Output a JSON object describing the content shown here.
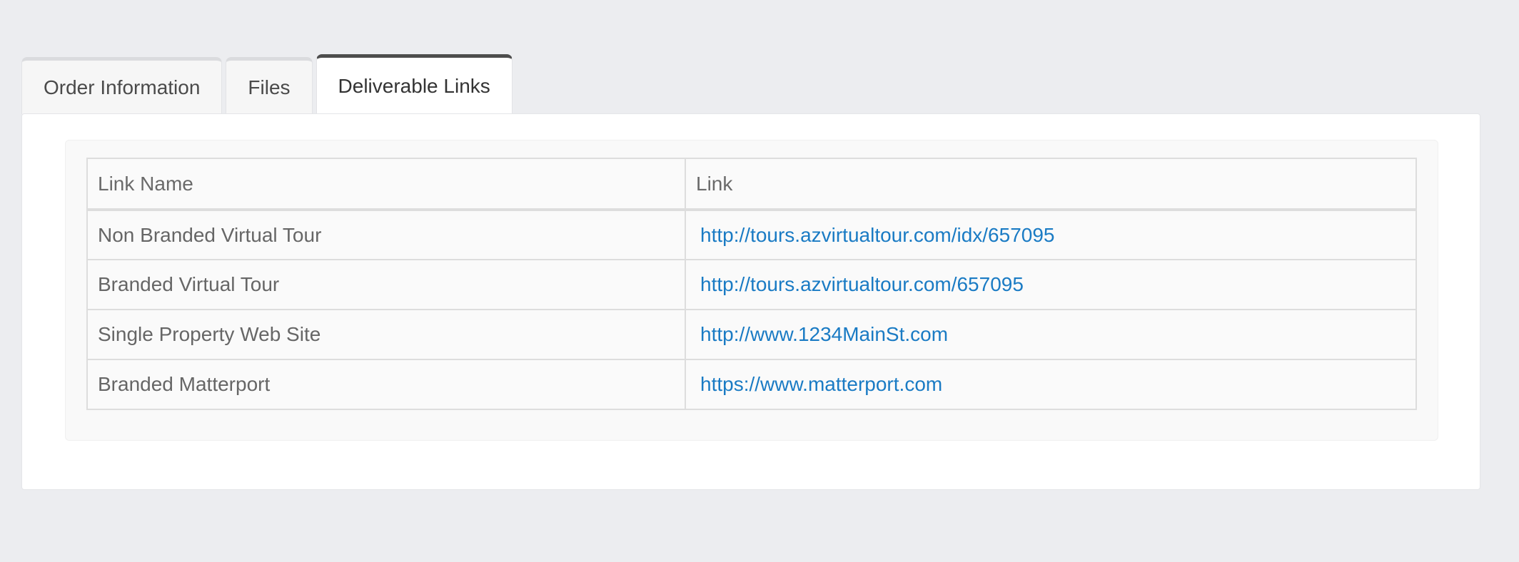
{
  "tabs": [
    {
      "label": "Order Information"
    },
    {
      "label": "Files"
    },
    {
      "label": "Deliverable Links"
    }
  ],
  "table": {
    "headers": {
      "name": "Link Name",
      "link": "Link"
    },
    "rows": [
      {
        "name": "Non Branded Virtual Tour",
        "link": "http://tours.azvirtualtour.com/idx/657095"
      },
      {
        "name": "Branded Virtual Tour",
        "link": "http://tours.azvirtualtour.com/657095"
      },
      {
        "name": "Single Property Web Site",
        "link": "http://www.1234MainSt.com"
      },
      {
        "name": "Branded Matterport",
        "link": "https://www.matterport.com"
      }
    ]
  },
  "colors": {
    "link": "#1a7bc4",
    "active_tab_border": "#4d4d4d",
    "background": "#ecedf0"
  }
}
